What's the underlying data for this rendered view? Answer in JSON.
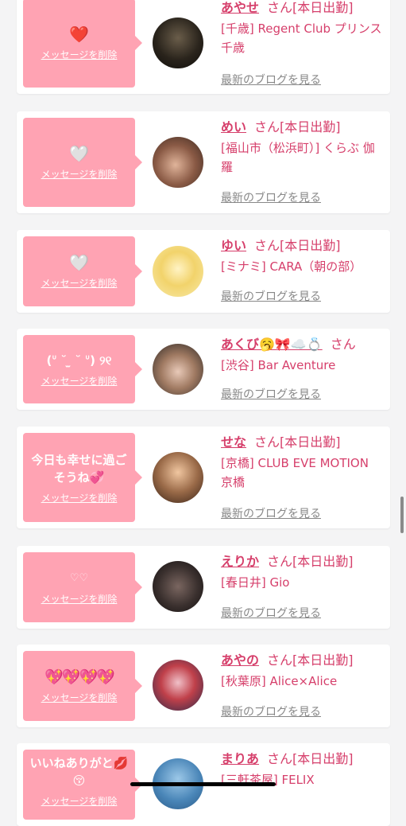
{
  "colors": {
    "accent": "#d63f6b",
    "bubble": "#ffa3b3",
    "background": "#f4f4f5"
  },
  "delete_label": "メッセージを削除",
  "blog_label": "最新のブログを見る",
  "honorific": "さん",
  "cards": [
    {
      "message": "❤️",
      "name": "あやせ",
      "status": "[本日出勤]",
      "shop": "[千歳] Regent Club プリンス 千歳"
    },
    {
      "message": "🤍",
      "name": "めい",
      "status": "[本日出勤]",
      "shop": "[福山市（松浜町）] くらぶ 伽羅"
    },
    {
      "message": "🤍",
      "name": "ゆい",
      "status": "[本日出勤]",
      "shop": "[ミナミ] CARA（朝の部）"
    },
    {
      "message": "(ᐡ ˘ ̫ ˘ ᐡ) ୨୧",
      "name": "あくび🥱🎀☁️💍",
      "status": "",
      "shop": "[渋谷] Bar Aventure"
    },
    {
      "message": "今日も幸せに過ごそうね💞",
      "name": "せな",
      "status": "[本日出勤]",
      "shop": "[京橋] CLUB EVE MOTION 京橋"
    },
    {
      "message": "♡♡",
      "name": "えりか",
      "status": "[本日出勤]",
      "shop": "[春日井] Gio"
    },
    {
      "message": "💖💖💖💖",
      "name": "あやの",
      "status": "[本日出勤]",
      "shop": "[秋葉原] Alice×Alice"
    },
    {
      "message": "いいねありがと💋😚",
      "name": "まりあ",
      "status": "[本日出勤]",
      "shop": "[三軒茶屋] FELIX"
    }
  ]
}
